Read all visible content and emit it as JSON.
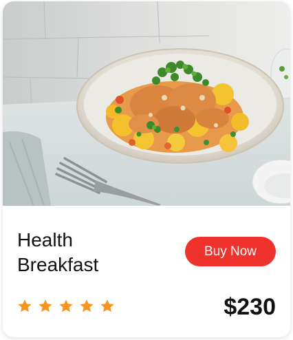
{
  "card": {
    "title_line1": "Health",
    "title_line2": "Breakfast",
    "buy_button_label": "Buy Now",
    "price": "$230",
    "rating": {
      "value": 5,
      "max": 5
    },
    "image": {
      "alt": "Health Breakfast"
    }
  },
  "colors": {
    "accent": "#f0322d",
    "star": "#f7941d",
    "text": "#111111"
  },
  "icons": {
    "rating": "star-icon"
  }
}
